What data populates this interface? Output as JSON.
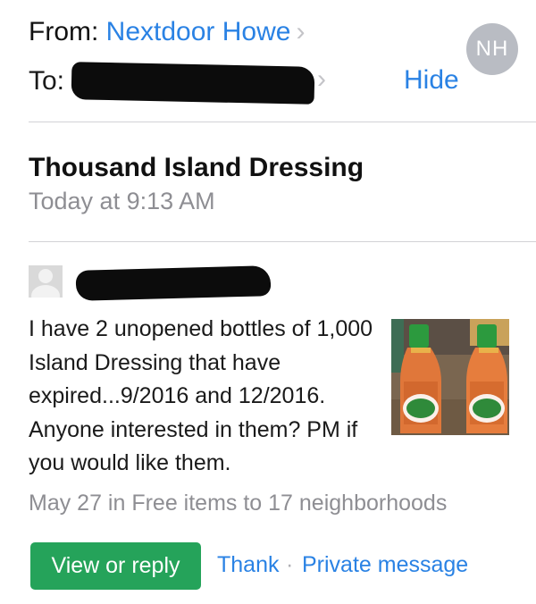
{
  "header": {
    "from_label": "From:",
    "sender_name": "Nextdoor Howe",
    "avatar_initials": "NH",
    "to_label": "To:",
    "hide_label": "Hide"
  },
  "message": {
    "subject": "Thousand Island Dressing",
    "date": "Today at 9:13 AM"
  },
  "post": {
    "body": "I have 2 unopened bottles of 1,000 Island Dressing that have expired...9/2016 and 12/2016. Anyone interested in them? PM if you would like them.",
    "meta": "May 27 in Free items to 17 neighborhoods",
    "photo_icon": "dressing-bottles-photo"
  },
  "actions": {
    "view_reply": "View or reply",
    "thank": "Thank",
    "separator": "·",
    "private_message": "Private message"
  },
  "colors": {
    "link": "#2a82e4",
    "button": "#25a35a",
    "muted": "#8e8e93",
    "avatar": "#b9bcc3"
  }
}
